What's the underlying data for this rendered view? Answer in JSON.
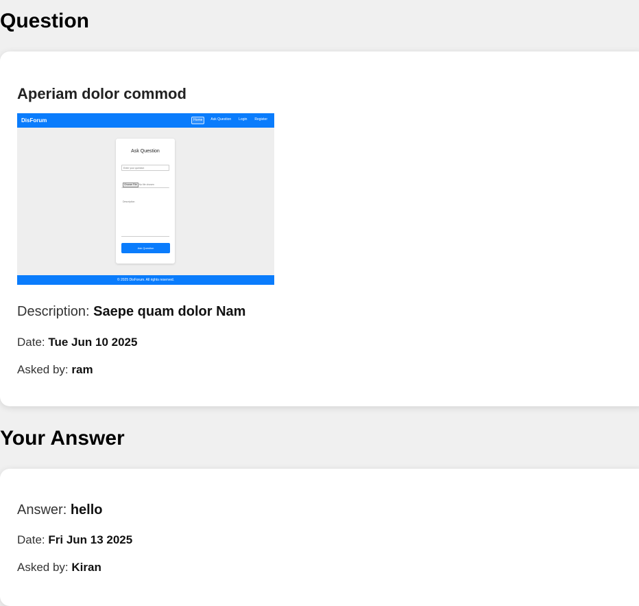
{
  "question_section": {
    "heading": "Question",
    "title": "Aperiam dolor commod",
    "description_label": "Description:",
    "description": "Saepe quam dolor Nam",
    "date_label": "Date:",
    "date": "Tue Jun 10 2025",
    "asked_by_label": "Asked by:",
    "asked_by": "ram",
    "screenshot": {
      "brand": "DisForum",
      "nav": [
        "Home",
        "Ask Question",
        "Login",
        "Register"
      ],
      "panel_title": "Ask Question",
      "question_placeholder": "Enter your question",
      "file_button": "Choose File",
      "file_status": "No file chosen",
      "description_placeholder": "Description",
      "submit_label": "Ask Question",
      "footer": "© 2025 DisForum. All rights reserved."
    }
  },
  "answer_section": {
    "heading": "Your Answer",
    "answer_label": "Answer:",
    "answer": "hello",
    "date_label": "Date:",
    "date": "Fri Jun 13 2025",
    "asked_by_label": "Asked by:",
    "asked_by": "Kiran"
  },
  "colors": {
    "page_background": "#f0f0f0",
    "card_background": "#ffffff",
    "screenshot_accent": "#0a7cfc"
  }
}
